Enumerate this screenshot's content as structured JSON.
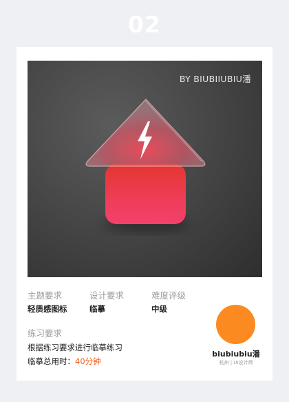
{
  "header": {
    "number": "02"
  },
  "hero": {
    "credit": "BY BIUBIIUBIU潘"
  },
  "info": {
    "theme_label": "主题要求",
    "theme_value": "轻质感图标",
    "design_label": "设计要求",
    "design_value": "临摹",
    "difficulty_label": "难度评级",
    "difficulty_value": "中级",
    "practice_label": "练习要求",
    "practice_value": "根据练习要求进行临摹练习",
    "time_label": "临摹总用时：",
    "time_value": "40分钟"
  },
  "author": {
    "name": "biubiubiu潘",
    "subtitle": "杭州 | UI设计师"
  },
  "colors": {
    "accent": "#f05a1a",
    "avatar": "#fb8a21",
    "icon_red": "#ea3a3a",
    "icon_pink": "#f2426b"
  },
  "icons": [
    "upload-arrow-icon",
    "lightning-bolt-icon"
  ]
}
